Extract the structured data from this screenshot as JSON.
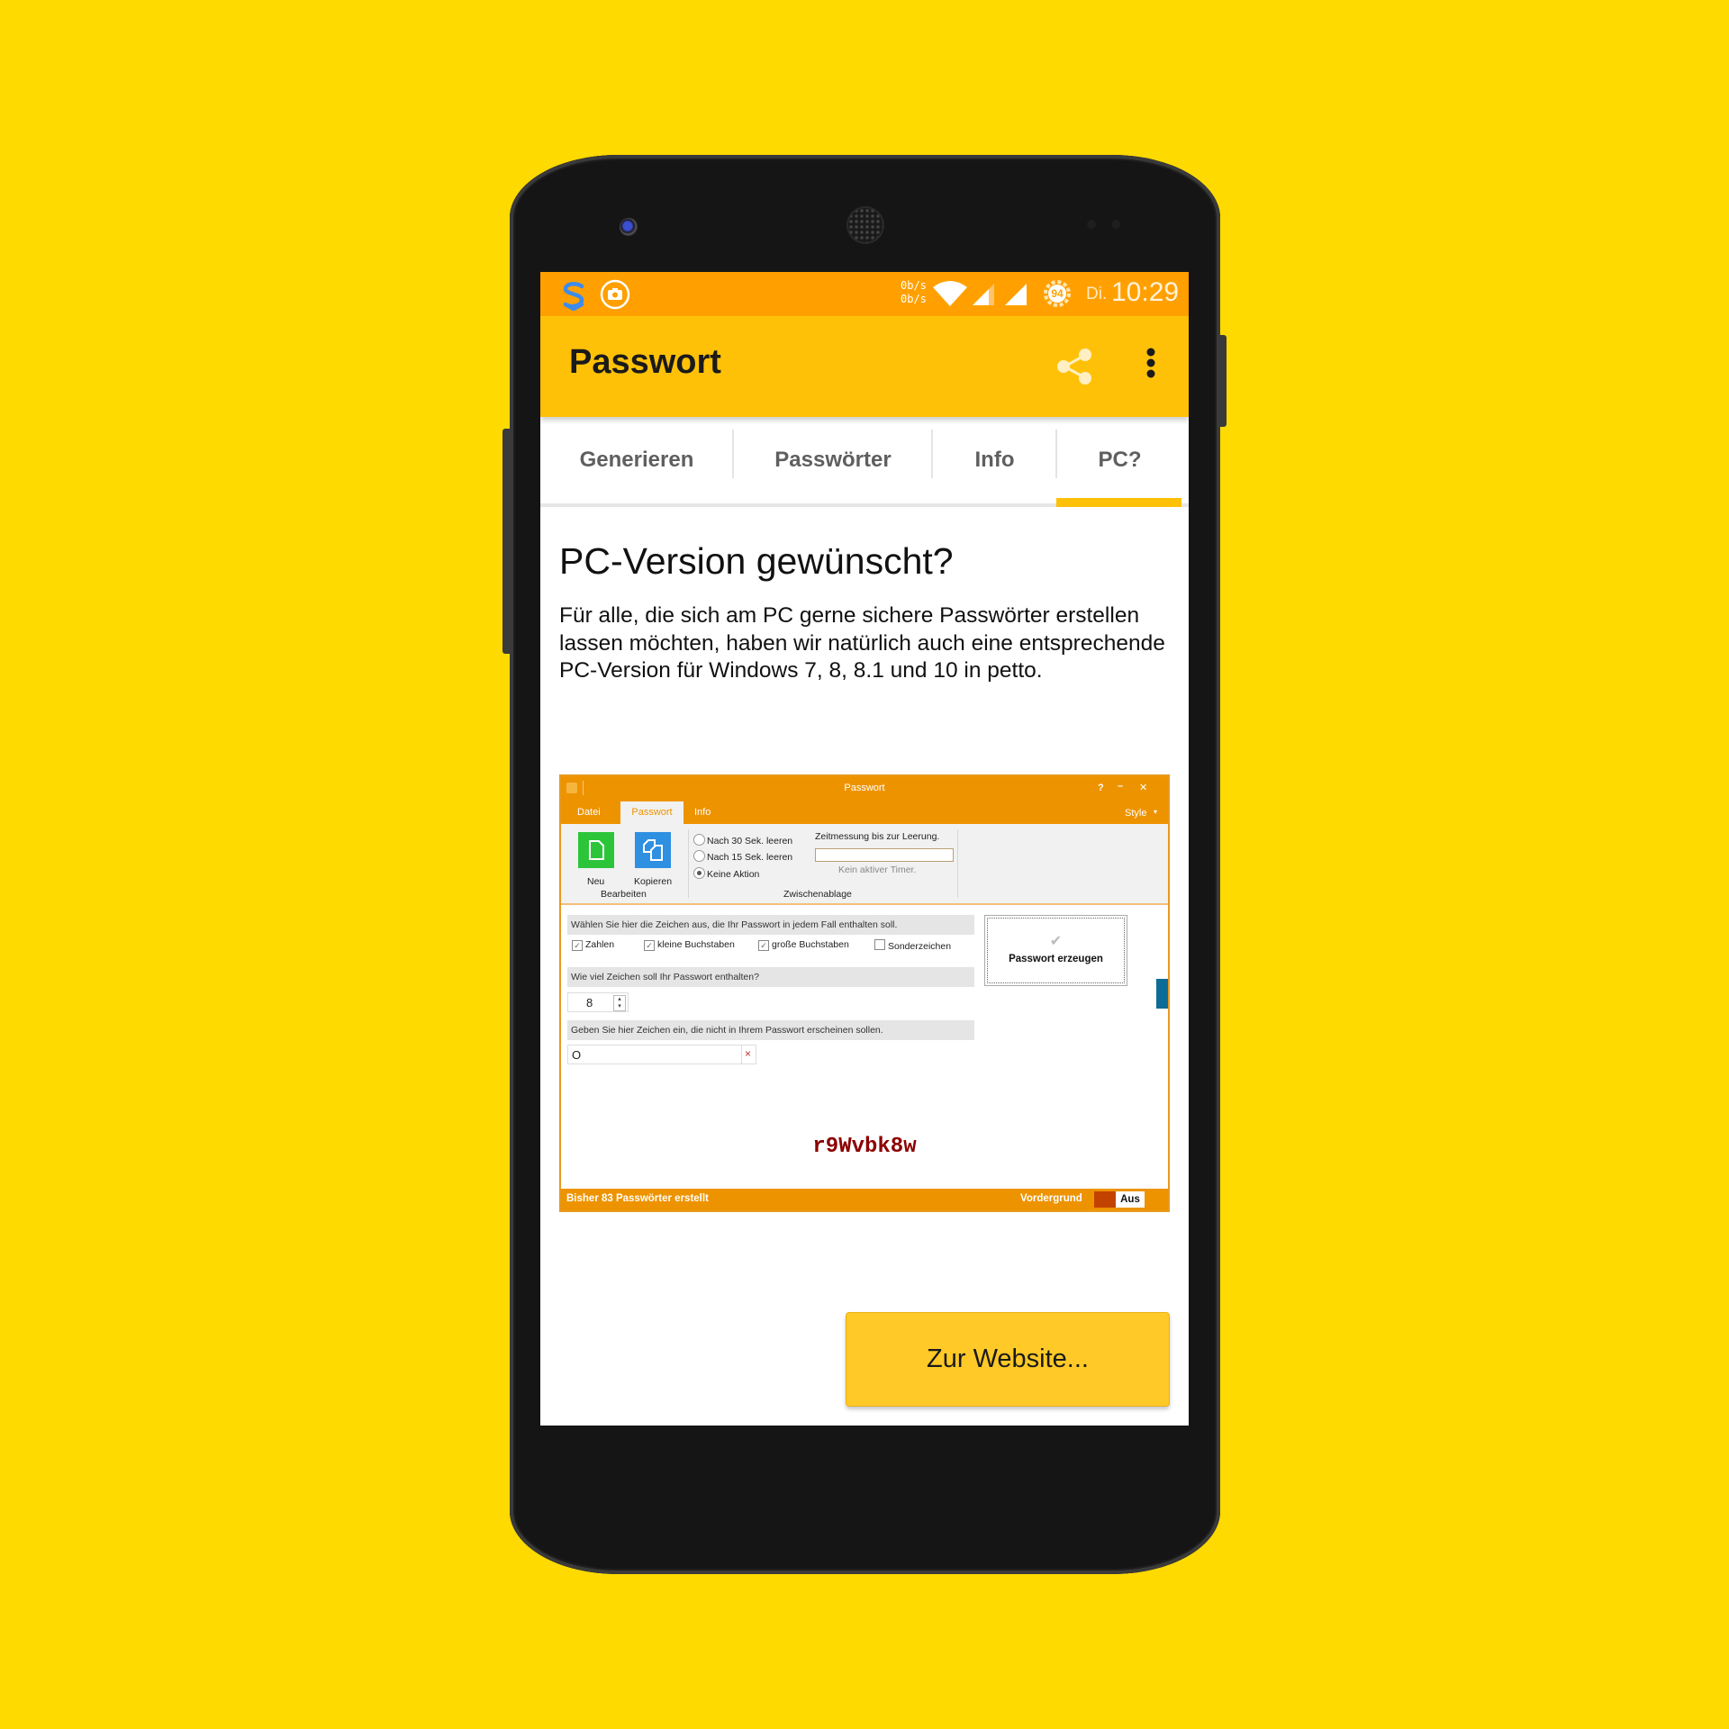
{
  "colors": {
    "background": "#FFDA00",
    "status_bar": "#FFA000",
    "app_bar": "#FFC107",
    "tab_indicator": "#FFC107",
    "pc_window_accent": "#EE9300",
    "password_text": "#8B0000",
    "cta_button": "#FFC928"
  },
  "status_bar": {
    "left_icons": [
      "shield-s-app-icon",
      "screenshot-camera-icon"
    ],
    "net_speed_up": "0b/s",
    "net_speed_down": "0b/s",
    "right_icons": [
      "wifi-icon",
      "signal-icon",
      "signal-icon",
      "battery-circle-icon"
    ],
    "battery_level": "94",
    "day": "Di.",
    "time": "10:29"
  },
  "app_bar": {
    "title": "Passwort",
    "actions": [
      "share-icon",
      "more-vert-icon"
    ]
  },
  "tabs": [
    {
      "label": "Generieren",
      "active": false
    },
    {
      "label": "Passwörter",
      "active": false
    },
    {
      "label": "Info",
      "active": false
    },
    {
      "label": "PC?",
      "active": true
    }
  ],
  "content": {
    "heading": "PC-Version gewünscht?",
    "body": "Für alle, die sich am PC gerne sichere Passwörter erstellen lassen möchten, haben wir natürlich auch eine entsprechende PC-Version für Windows 7, 8, 8.1 und 10 in petto."
  },
  "pc_screenshot": {
    "window_title": "Passwort",
    "window_controls": [
      "?",
      "–",
      "✕"
    ],
    "menu_tabs": [
      {
        "label": "Datei",
        "active": false
      },
      {
        "label": "Passwort",
        "active": true
      },
      {
        "label": "Info",
        "active": false
      }
    ],
    "style_menu": "Style",
    "ribbon": {
      "bearbeiten_group": "Bearbeiten",
      "new_label": "Neu",
      "copy_label": "Kopieren",
      "clipboard_group": "Zwischenablage",
      "radio_options": [
        {
          "label": "Nach 30 Sek. leeren",
          "selected": false
        },
        {
          "label": "Nach 15 Sek. leeren",
          "selected": false
        },
        {
          "label": "Keine Aktion",
          "selected": true
        }
      ],
      "timer_label": "Zeitmessung bis zur Leerung.",
      "timer_status": "Kein aktiver Timer."
    },
    "chars_prompt": "Wählen Sie hier die Zeichen aus, die Ihr Passwort in jedem Fall enthalten soll.",
    "char_options": [
      {
        "label": "Zahlen",
        "checked": true
      },
      {
        "label": "kleine Buchstaben",
        "checked": true
      },
      {
        "label": "große Buchstaben",
        "checked": true
      },
      {
        "label": "Sonderzeichen",
        "checked": false
      }
    ],
    "length_prompt": "Wie viel Zeichen soll Ihr Passwort enthalten?",
    "length_value": "8",
    "exclude_prompt": "Geben Sie hier Zeichen ein, die nicht in Ihrem Passwort erscheinen sollen.",
    "exclude_value": "O",
    "generate_button": "Passwort erzeugen",
    "generated_password": "r9Wvbk8w",
    "status_left": "Bisher 83 Passwörter erstellt",
    "status_right_label": "Vordergrund",
    "toggle_label": "Aus"
  },
  "cta_button": "Zur Website..."
}
